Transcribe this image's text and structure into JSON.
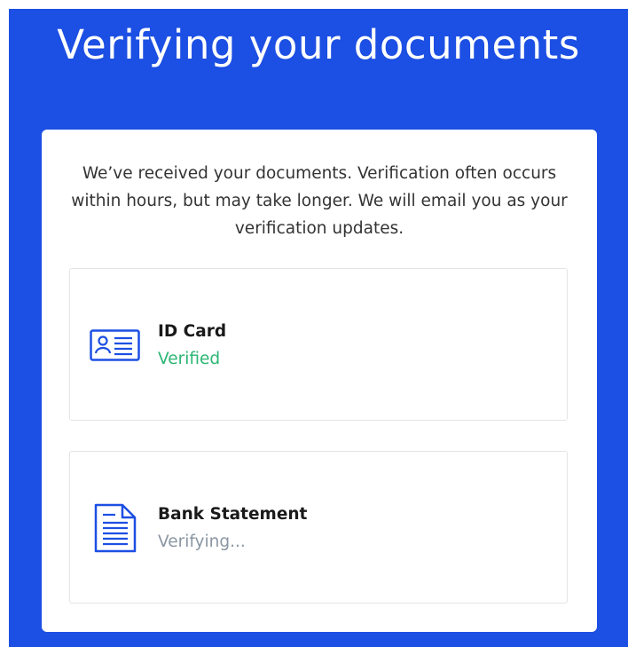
{
  "page": {
    "title": "Verifying your documents",
    "intro": "We’ve received your documents. Verification often occurs within hours, but may take longer. We will email you as your verification updates."
  },
  "documents": [
    {
      "name": "ID Card",
      "status": "Verified",
      "status_color": "#2bb673",
      "icon": "id-card-icon"
    },
    {
      "name": "Bank Statement",
      "status": "Verifying...",
      "status_color": "#8a96a3",
      "icon": "document-icon"
    }
  ],
  "colors": {
    "background": "#1c4fe3",
    "card": "#ffffff",
    "icon": "#1c4fe3"
  }
}
